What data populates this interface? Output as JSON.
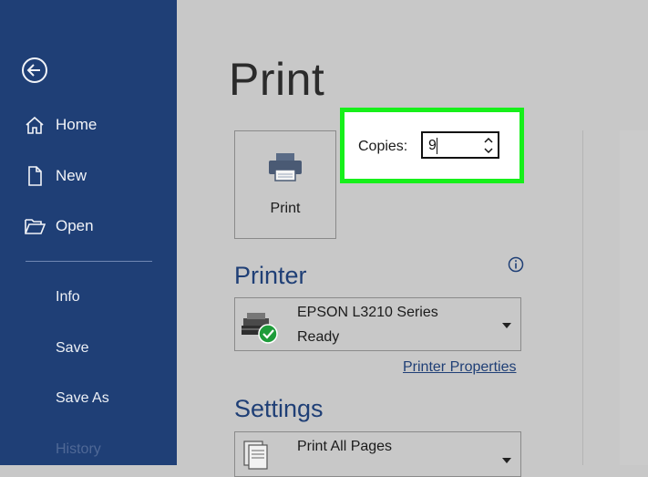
{
  "sidebar": {
    "items": [
      {
        "label": "Home",
        "icon": "home-icon"
      },
      {
        "label": "New",
        "icon": "new-document-icon"
      },
      {
        "label": "Open",
        "icon": "folder-open-icon"
      }
    ],
    "sub_items": [
      "Info",
      "Save",
      "Save As",
      "History"
    ]
  },
  "page": {
    "title": "Print"
  },
  "print_button": {
    "label": "Print",
    "icon": "printer-icon"
  },
  "copies": {
    "label": "Copies:",
    "value": "9"
  },
  "printer": {
    "heading": "Printer",
    "name": "EPSON L3210 Series",
    "status": "Ready",
    "properties_link": "Printer Properties"
  },
  "settings": {
    "heading": "Settings",
    "pages_option": "Print All Pages"
  },
  "colors": {
    "sidebar": "#1f3f76",
    "accent": "#1f3f76",
    "highlight": "#16f01a",
    "background": "#c8c8c8"
  }
}
